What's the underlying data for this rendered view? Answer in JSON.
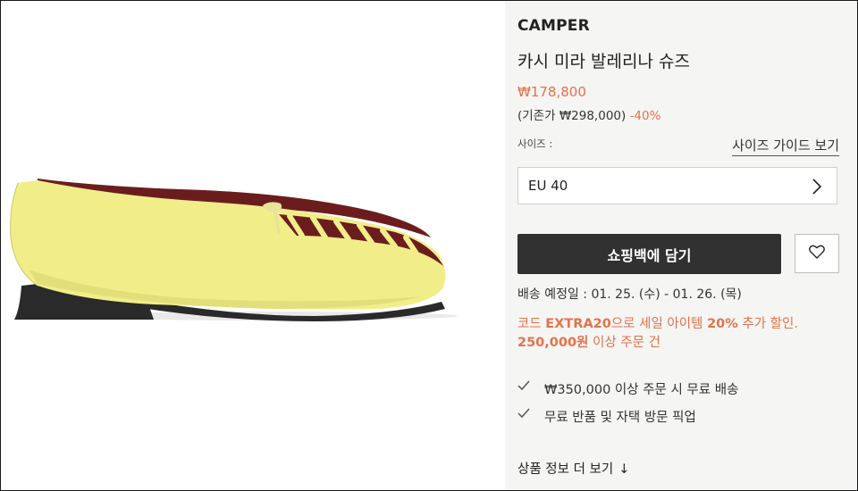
{
  "product": {
    "brand": "CAMPER",
    "name": "카시 미라 발레리나 슈즈",
    "price": "₩178,800",
    "original_prefix": "(기존가 ₩298,000)",
    "discount": "-40%",
    "image_alt": "yellow leather ballerina shoe with burgundy woven toe"
  },
  "size": {
    "label": "사이즈 :",
    "guide_link": "사이즈 가이드 보기",
    "selected": "EU 40"
  },
  "actions": {
    "add_to_cart": "쇼핑백에 담기",
    "wishlist_icon": "heart-icon"
  },
  "delivery": {
    "text": "배송 예정일 : 01. 25. (수) - 01. 26. (목)"
  },
  "promo": {
    "part1": "코드 ",
    "code": "EXTRA20",
    "part2": "으로 세일 아이템 ",
    "percent": "20%",
    "part3": " 추가 할인.",
    "line2": "250,000원",
    "line2_rest": " 이상 주문 건"
  },
  "benefits": [
    {
      "icon": "check-icon",
      "text": "₩350,000 이상 주문 시 무료 배송"
    },
    {
      "icon": "check-icon",
      "text": "무료 반품 및 자택 방문 픽업"
    }
  ],
  "details_link": {
    "label": "상품 정보 더 보기",
    "icon": "arrow-down-icon"
  },
  "colors": {
    "accent": "#e2734c",
    "button_dark": "#313131",
    "panel_bg": "#f5f5f3",
    "shoe_yellow": "#f1ee8a",
    "shoe_burgundy": "#6b1d1d"
  }
}
